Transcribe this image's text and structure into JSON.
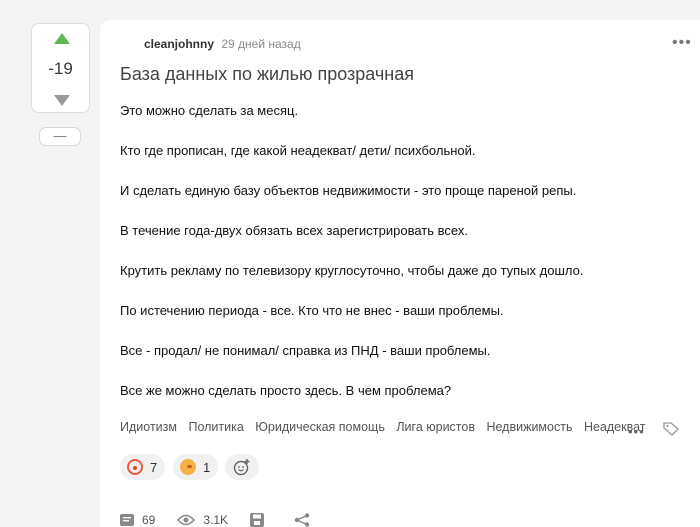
{
  "vote": {
    "score": "-19",
    "collapse_label": "—"
  },
  "post": {
    "author": "cleanjohnny",
    "time": "29 дней назад",
    "title": "База данных по жилью прозрачная",
    "paragraphs": [
      "Это можно сделать за месяц.",
      "Кто где прописан, где какой неадекват/ дети/ психбольной.",
      "И сделать единую базу объектов недвижимости - это проще пареной репы.",
      "В течение года-двух обязать всех зарегистрировать всех.",
      "Крутить рекламу по телевизору круглосуточно, чтобы даже до тупых дошло.",
      "По истечению периода - все. Кто что не внес - ваши проблемы.",
      "Все - продал/ не понимал/ справка из ПНД - ваши проблемы.",
      "Все же можно сделать просто здесь. В чем проблема?"
    ],
    "tags": [
      "Идиотизм",
      "Политика",
      "Юридическая помощь",
      "Лига юристов",
      "Недвижимость",
      "Неадекват"
    ],
    "tags_more": "•••",
    "more_menu": "•••"
  },
  "reactions": [
    {
      "icon": "clown-emoji-icon",
      "count": "7"
    },
    {
      "icon": "fire-emoji-icon",
      "count": "1"
    }
  ],
  "footer": {
    "comments": "69",
    "views": "3.1K"
  },
  "colors": {
    "upvote": "#5bb84f",
    "downvote": "#9a9a9a",
    "background": "#f4f4f5"
  }
}
